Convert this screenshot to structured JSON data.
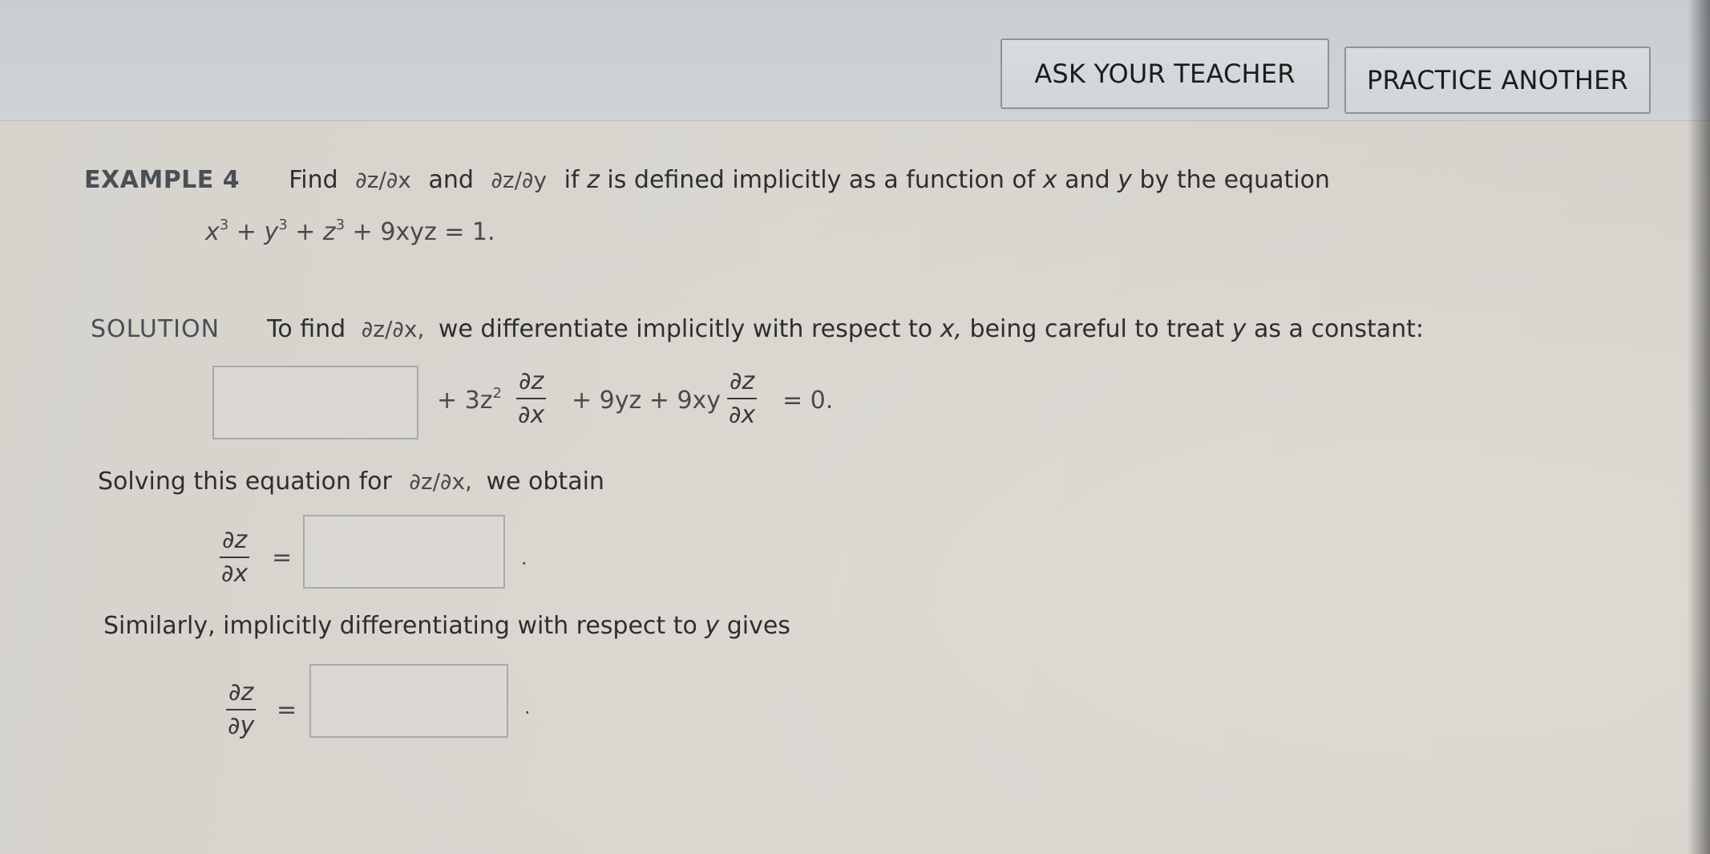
{
  "buttons": {
    "ask": "ASK YOUR TEACHER",
    "practice": "PRACTICE ANOTHER"
  },
  "example": {
    "label": "EXAMPLE 4",
    "prompt_find": "Find",
    "dzdx": "∂z/∂x",
    "and": "and",
    "dzdy": "∂z/∂y",
    "prompt_rest_1": "if",
    "z": "z",
    "prompt_rest_2": "is defined implicitly as a function of",
    "x": "x",
    "and2": "and",
    "y": "y",
    "prompt_rest_3": "by the equation",
    "equation": {
      "t1": "x",
      "t2": "y",
      "t3": "z",
      "exp": "3",
      "plus": "+",
      "t4": "9xyz = 1."
    }
  },
  "solution": {
    "label": "SOLUTION",
    "text_1": "To find",
    "dzdx": "∂z/∂x,",
    "text_2": "we differentiate implicitly with respect to",
    "x": "x,",
    "text_3": "being careful to treat",
    "y": "y",
    "text_4": "as a constant:",
    "equation": {
      "plus_1": "+ 3z",
      "exp": "2",
      "frac_num": "∂z",
      "frac_den": "∂x",
      "mid": "+ 9yz + 9xy",
      "end": "= 0."
    }
  },
  "solve_x": {
    "text": "Solving this equation for",
    "dzdx": "∂z/∂x,",
    "text_2": "we obtain",
    "frac_num": "∂z",
    "frac_den": "∂x",
    "eq": "=",
    "period": "."
  },
  "solve_y": {
    "text": "Similarly, implicitly differentiating with respect to",
    "y": "y",
    "text_2": "gives",
    "frac_num": "∂z",
    "frac_den": "∂y",
    "eq": "=",
    "period": "."
  }
}
